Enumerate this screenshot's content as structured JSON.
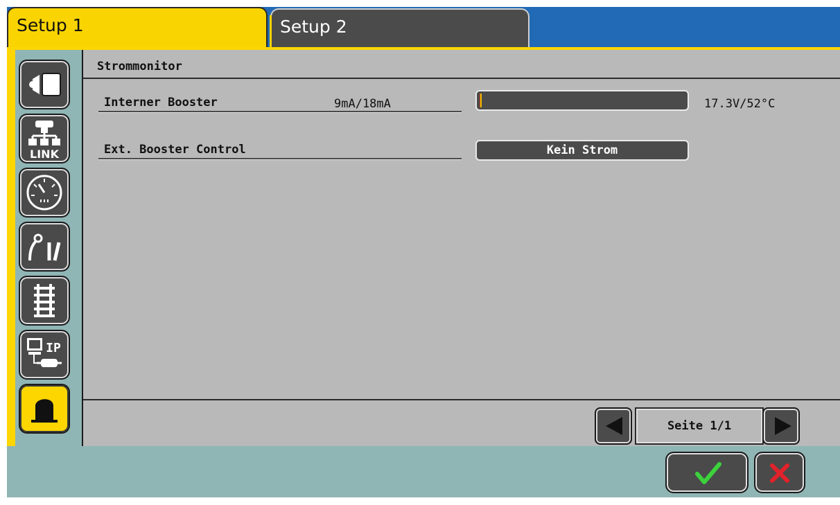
{
  "tabs": [
    {
      "label": "Setup 1",
      "active": true
    },
    {
      "label": "Setup 2",
      "active": false
    }
  ],
  "sidebar": {
    "items": [
      {
        "icon": "track-output-icon",
        "selected": false
      },
      {
        "icon": "link-network-icon",
        "label": "LINK",
        "selected": false
      },
      {
        "icon": "gauge-clock-icon",
        "selected": false
      },
      {
        "icon": "signal-turnout-icon",
        "selected": false
      },
      {
        "icon": "track-rails-icon",
        "selected": false
      },
      {
        "icon": "ip-computer-icon",
        "label": "IP",
        "selected": false
      },
      {
        "icon": "booster-tunnel-icon",
        "selected": true
      }
    ]
  },
  "panel": {
    "title": "Strommonitor",
    "rows": [
      {
        "label": "Interner Booster",
        "current": "9mA/18mA",
        "meter_level": 0.01,
        "voltage_temp": "17.3V/52°C"
      },
      {
        "label": "Ext. Booster Control",
        "status": "Kein Strom"
      }
    ]
  },
  "pager": {
    "label": "Seite 1/1",
    "prev_icon": "arrow-left-icon",
    "next_icon": "arrow-right-icon"
  },
  "footer": {
    "ok_icon": "check-icon",
    "cancel_icon": "close-x-icon"
  },
  "colors": {
    "active_tab": "#fdd600",
    "inactive_tab": "#4b4b4b",
    "title_bar": "#226ab6",
    "sidebar": "#8fb5b5",
    "panel": "#b9b9b9",
    "meter_fill": "#d23a1a",
    "check": "#3cd23c",
    "cancel": "#e2222a"
  }
}
